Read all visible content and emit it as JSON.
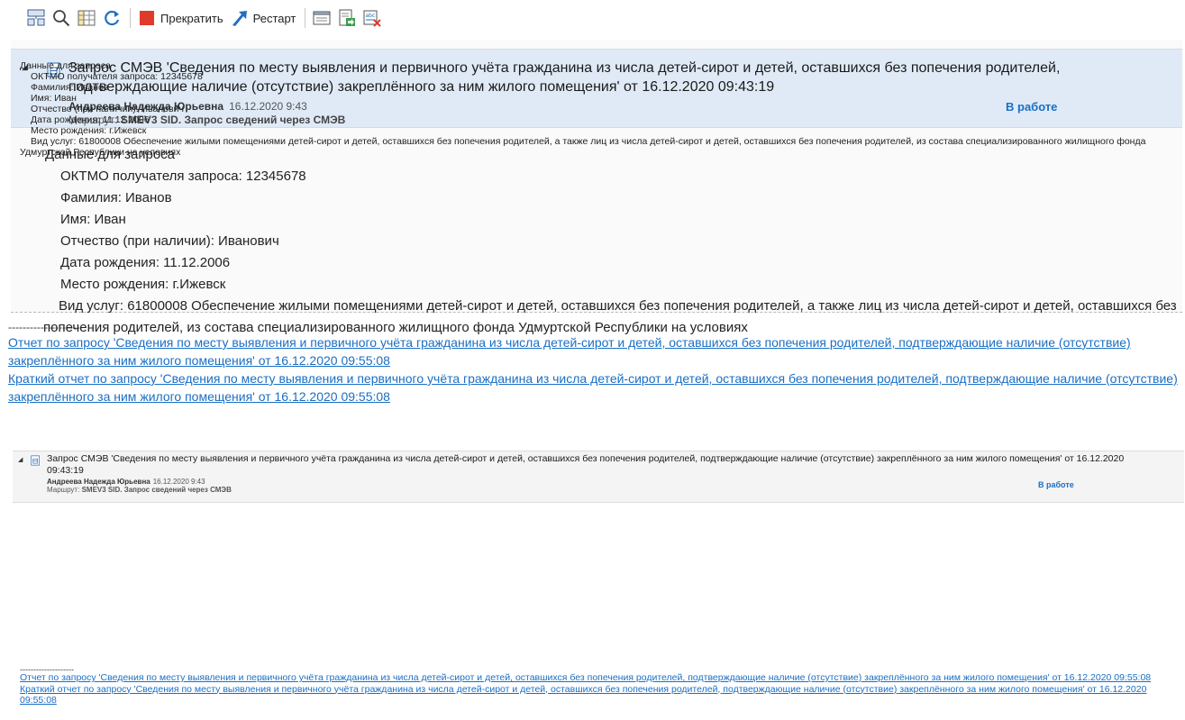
{
  "toolbar": {
    "stop_label": "Прекратить",
    "restart_label": "Рестарт"
  },
  "request": {
    "title": "Запрос СМЭВ 'Сведения по месту выявления и первичного учёта гражданина из числа детей-сирот и детей, оставшихся без попечения родителей, подтверждающие наличие (отсутствие) закреплённого за ним жилого помещения' от 16.12.2020 09:43:19",
    "author": "Андреева Надежда Юрьевна",
    "date": "16.12.2020 9:43",
    "route_label": "Маршрут:",
    "route_value": "SMEV3 SID. Запрос сведений через СМЭВ",
    "status": "В работе"
  },
  "details": {
    "heading": "Данные для запроса",
    "oktmo": "ОКТМО получателя запроса: 12345678",
    "surname": "Фамилия: Иванов",
    "name": "Имя: Иван",
    "patronymic": "Отчество (при наличии): Иванович",
    "birth_date": "Дата рождения: 11.12.2006",
    "birth_place": "Место рождения: г.Ижевск",
    "service_type": "Вид услуг: 61800008 Обеспечение жилыми помещениями детей-сирот и детей, оставшихся без попечения родителей, а также лиц из числа детей-сирот и детей, оставшихся без попечения родителей, из состава специализированного жилищного фонда Удмуртской Республики на условиях"
  },
  "separator": "--------------------",
  "links": {
    "report": "Отчет по запросу 'Сведения по месту выявления и первичного учёта гражданина из числа детей-сирот и детей, оставшихся без попечения родителей, подтверждающие наличие (отсутствие) закреплённого за ним жилого помещения' от 16.12.2020 09:55:08",
    "short_report": "Краткий отчет по запросу 'Сведения по месту выявления и первичного учёта гражданина из числа детей-сирот и детей, оставшихся без попечения родителей, подтверждающие наличие (отсутствие) закреплённого за ним жилого помещения' от 16.12.2020 09:55:08"
  },
  "colors": {
    "header_bg": "#dfeaf6",
    "link": "#1a6fc4",
    "stop": "#e03a2a",
    "restart": "#1f6fc0"
  }
}
